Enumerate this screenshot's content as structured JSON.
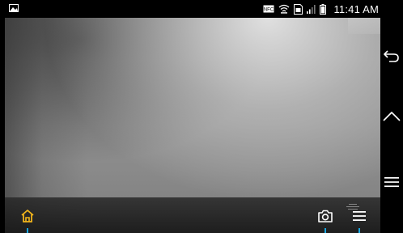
{
  "status_bar": {
    "time": "11:41 AM",
    "icons": [
      "gallery-icon",
      "nfc-icon",
      "wifi-icon",
      "sim-icon",
      "signal-icon",
      "battery-icon"
    ],
    "nfc_label": "NFC"
  },
  "camera_bar": {
    "buttons": [
      "home-icon",
      "camera-icon",
      "menu-icon"
    ]
  },
  "nav_bar": {
    "buttons": [
      "back-icon",
      "home-icon",
      "menu-icon"
    ]
  },
  "colors": {
    "accent": "#f2b51b",
    "indicator": "#19a6e0",
    "status_text": "#ffffff",
    "nav_icon": "#ffffff"
  }
}
